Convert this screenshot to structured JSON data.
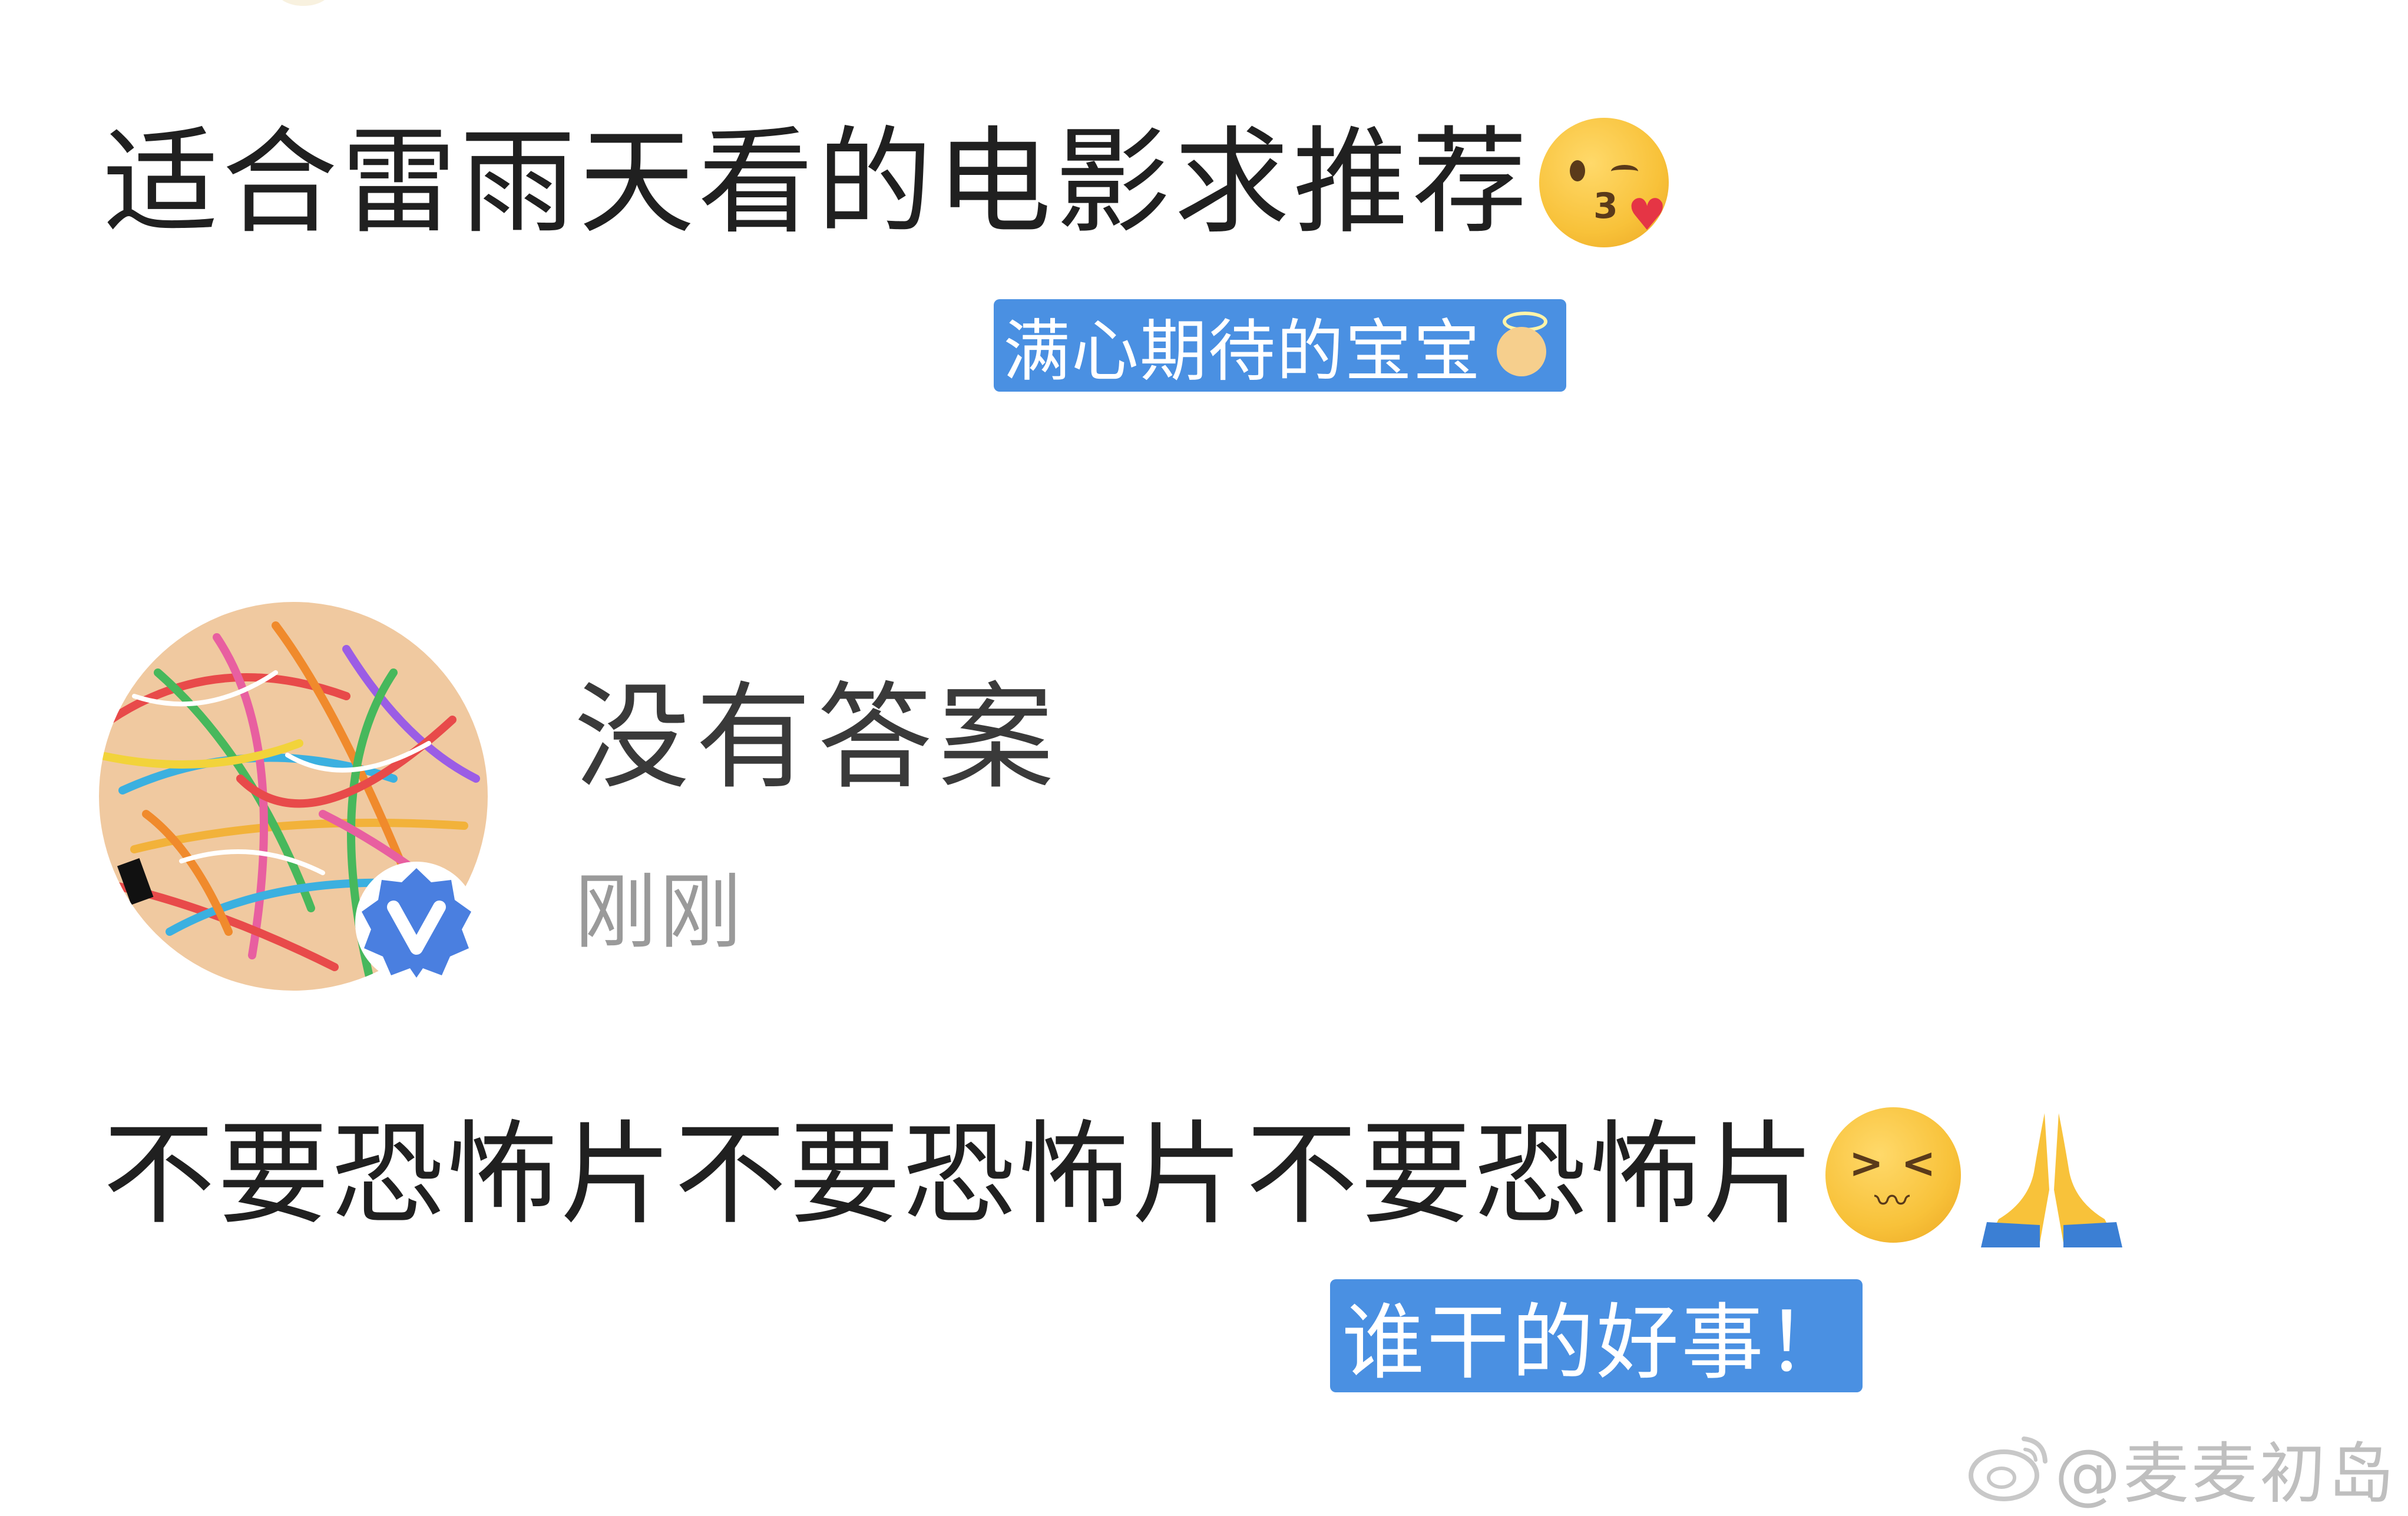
{
  "question": {
    "title": "适合雷雨天看的电影求推荐",
    "title_emoji": "kissing-face-with-heart-icon"
  },
  "captions": {
    "first": "满心期待的宝宝",
    "first_emoji": "baby-angel-icon",
    "second": "谁干的好事！"
  },
  "answer": {
    "name": "没有答案",
    "time": "刚刚",
    "text": "不要恐怖片不要恐怖片不要恐怖片",
    "emojis": [
      "confounded-face-icon",
      "folded-hands-icon"
    ],
    "verified": true
  },
  "watermark": {
    "text": "@麦麦初岛"
  },
  "colors": {
    "caption_bg": "#4a90e2",
    "caption_text": "#ffffff",
    "title_text": "#202020",
    "time_text": "#9a9a9a",
    "watermark_text": "#bfbfbf",
    "badge": "#4a7fe0"
  }
}
